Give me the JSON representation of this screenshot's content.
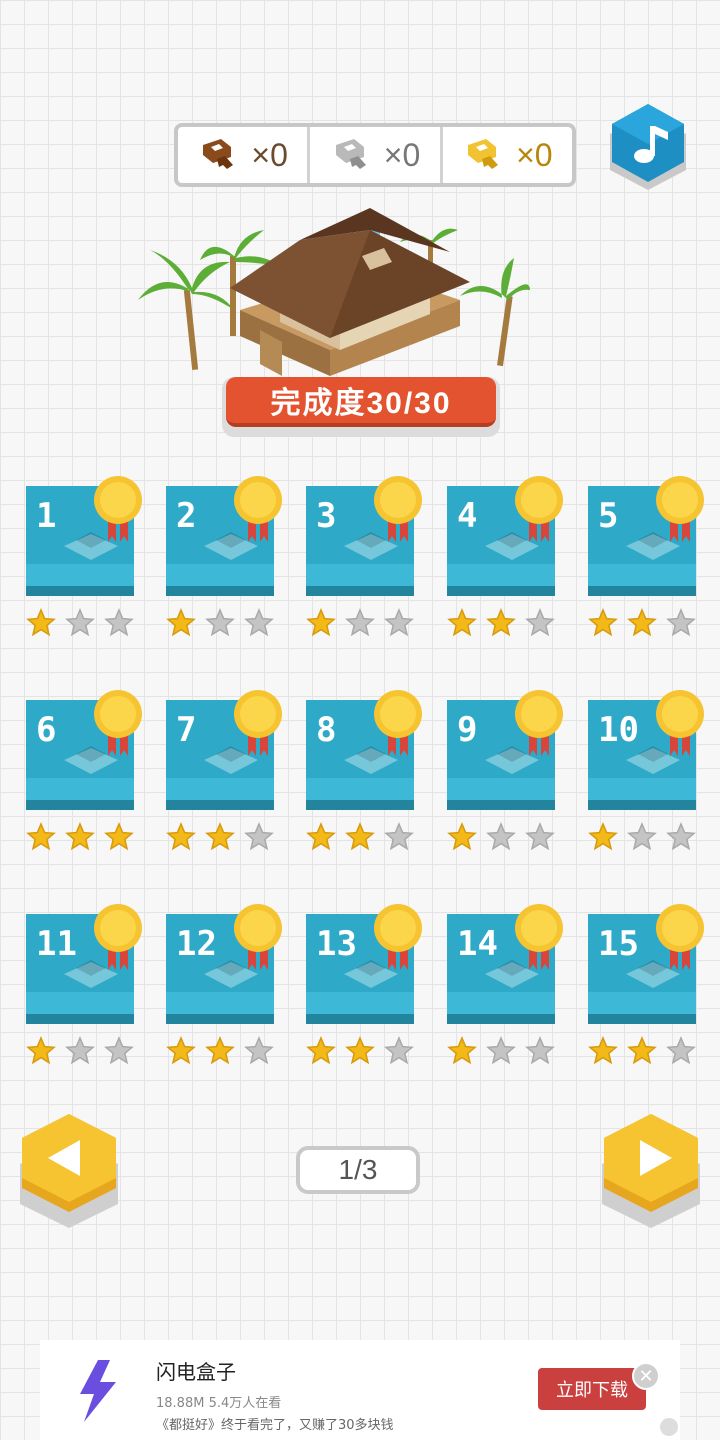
{
  "keys": [
    {
      "icon": "bronze-key-icon",
      "count": "×0",
      "color": "#8a4a1c"
    },
    {
      "icon": "silver-key-icon",
      "count": "×0",
      "color": "#b9b9b9"
    },
    {
      "icon": "gold-key-icon",
      "count": "×0",
      "color": "#f1c232"
    }
  ],
  "progress": {
    "text": "完成度30/30"
  },
  "levels": [
    {
      "number": "1",
      "stars": 1
    },
    {
      "number": "2",
      "stars": 1
    },
    {
      "number": "3",
      "stars": 1
    },
    {
      "number": "4",
      "stars": 2
    },
    {
      "number": "5",
      "stars": 2
    },
    {
      "number": "6",
      "stars": 3
    },
    {
      "number": "7",
      "stars": 2
    },
    {
      "number": "8",
      "stars": 2
    },
    {
      "number": "9",
      "stars": 1
    },
    {
      "number": "10",
      "stars": 1
    },
    {
      "number": "11",
      "stars": 1
    },
    {
      "number": "12",
      "stars": 2
    },
    {
      "number": "13",
      "stars": 2
    },
    {
      "number": "14",
      "stars": 1
    },
    {
      "number": "15",
      "stars": 2
    }
  ],
  "pagination": {
    "label": "1/3"
  },
  "ad": {
    "title": "闪电盒子",
    "meta": "18.88M 5.4万人在看",
    "desc": "《都挺好》终于看完了，又赚了30多块钱",
    "cta": "立即下载",
    "close": "✕"
  },
  "colors": {
    "tile": "#2fa9c8",
    "accent_red": "#e3532f",
    "gold": "#f6c431",
    "star_filled": "#f2b918",
    "star_empty": "#c4c4c4"
  }
}
